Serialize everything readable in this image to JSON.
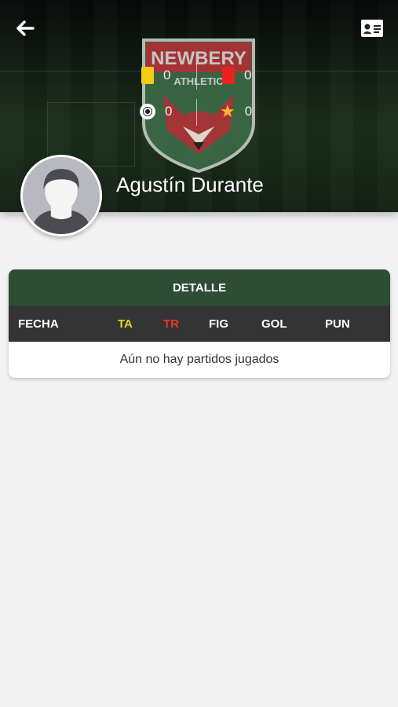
{
  "header": {
    "back_icon": "arrow-left-icon",
    "card_icon": "id-card-icon",
    "crest_text_top": "NEWBERY",
    "crest_text_mid": "ATHLETIC",
    "stats": {
      "yellow_cards": "0",
      "red_cards": "0",
      "goals": "0",
      "stars": "0"
    },
    "player_name": "Agustín Durante"
  },
  "detail": {
    "title": "DETALLE",
    "columns": {
      "fecha": "FECHA",
      "ta": "TA",
      "tr": "TR",
      "fig": "FIG",
      "gol": "GOL",
      "pun": "PUN"
    },
    "empty_message": "Aún no hay partidos jugados"
  },
  "colors": {
    "header_green": "#2d4d34",
    "columns_bg": "#343434",
    "ta_color": "#e6d320",
    "tr_color": "#e03a2c"
  }
}
